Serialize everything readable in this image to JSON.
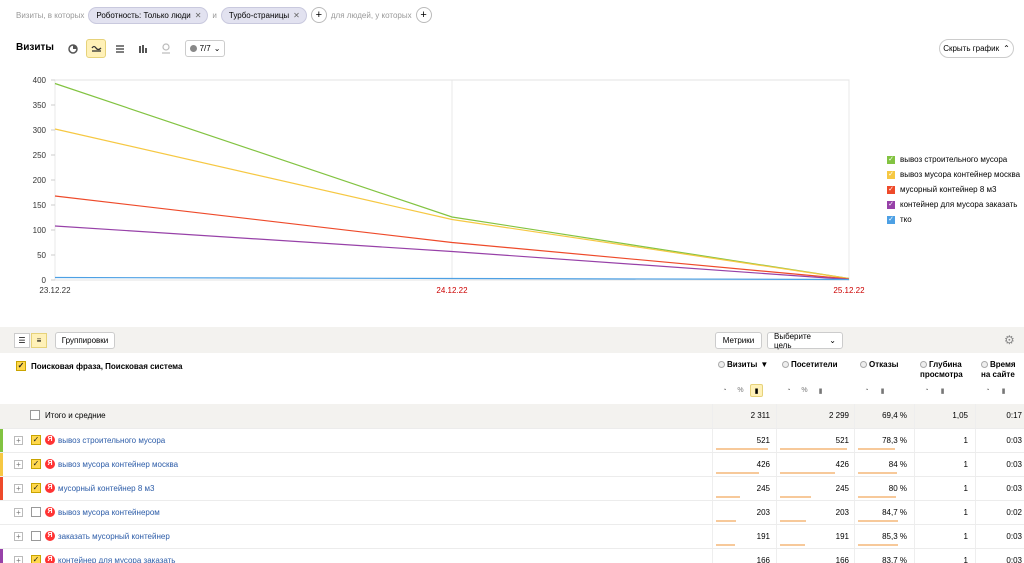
{
  "segment": {
    "lead_text": "Визиты, в которых",
    "chip1": "Роботность: Только люди",
    "joiner": "и",
    "chip2": "Турбо-страницы",
    "trail_text": "для людей, у которых"
  },
  "chart_header": {
    "title": "Визиты",
    "series_count": "7/7",
    "hide_label": "Скрыть график"
  },
  "chart_data": {
    "type": "line",
    "x": [
      "23.12.22",
      "24.12.22",
      "25.12.22"
    ],
    "ylim": [
      0,
      400
    ],
    "yticks": [
      0,
      50,
      100,
      150,
      200,
      250,
      300,
      350,
      400
    ],
    "grid": true,
    "legend_position": "right",
    "series": [
      {
        "name": "вывоз строительного мусора",
        "color": "#82c341",
        "values": [
          393,
          126,
          3
        ]
      },
      {
        "name": "вывоз мусора контейнер москва",
        "color": "#f6c843",
        "values": [
          302,
          121,
          3
        ]
      },
      {
        "name": "мусорный контейнер 8 м3",
        "color": "#ee4a2a",
        "values": [
          168,
          75,
          2
        ]
      },
      {
        "name": "контейнер для мусора заказать",
        "color": "#9741a8",
        "values": [
          108,
          57,
          1
        ]
      },
      {
        "name": "тко",
        "color": "#4da0e4",
        "values": [
          5,
          3,
          1
        ]
      }
    ]
  },
  "table_toolbar": {
    "groupings": "Группировки",
    "metrics": "Метрики",
    "goal": "Выберите цель"
  },
  "table": {
    "dimension_header": "Поисковая фраза, Поисковая система",
    "columns": [
      {
        "label1": "Визиты",
        "label2": "",
        "sort": "▼"
      },
      {
        "label1": "Посетители",
        "label2": "",
        "sort": ""
      },
      {
        "label1": "Отказы",
        "label2": "",
        "sort": ""
      },
      {
        "label1": "Глубина",
        "label2": "просмотра",
        "sort": ""
      },
      {
        "label1": "Время",
        "label2": "на сайте",
        "sort": ""
      }
    ],
    "total": {
      "label": "Итого и средние",
      "values": [
        "2 311",
        "2 299",
        "69,4 %",
        "1,05",
        "0:17"
      ]
    },
    "rows": [
      {
        "label": "вывоз строительного мусора",
        "stripe": "#82c341",
        "checked": true,
        "values": [
          "521",
          "521",
          "78,3 %",
          "1",
          "0:03"
        ],
        "bars": [
          1.0,
          1.0,
          0.78
        ]
      },
      {
        "label": "вывоз мусора контейнер москва",
        "stripe": "#f6c843",
        "checked": true,
        "values": [
          "426",
          "426",
          "84 %",
          "1",
          "0:03"
        ],
        "bars": [
          0.82,
          0.82,
          0.84
        ]
      },
      {
        "label": "мусорный контейнер 8 м3",
        "stripe": "#ee4a2a",
        "checked": true,
        "values": [
          "245",
          "245",
          "80 %",
          "1",
          "0:03"
        ],
        "bars": [
          0.47,
          0.47,
          0.8
        ]
      },
      {
        "label": "вывоз мусора контейнером",
        "stripe": "",
        "checked": false,
        "values": [
          "203",
          "203",
          "84,7 %",
          "1",
          "0:02"
        ],
        "bars": [
          0.39,
          0.39,
          0.85
        ]
      },
      {
        "label": "заказать мусорный контейнер",
        "stripe": "",
        "checked": false,
        "values": [
          "191",
          "191",
          "85,3 %",
          "1",
          "0:03"
        ],
        "bars": [
          0.37,
          0.37,
          0.85
        ]
      },
      {
        "label": "контейнер для мусора заказать",
        "stripe": "#9741a8",
        "checked": true,
        "values": [
          "166",
          "166",
          "83,7 %",
          "1",
          "0:03"
        ],
        "bars": [
          0.32,
          0.32,
          0.84
        ]
      }
    ]
  }
}
